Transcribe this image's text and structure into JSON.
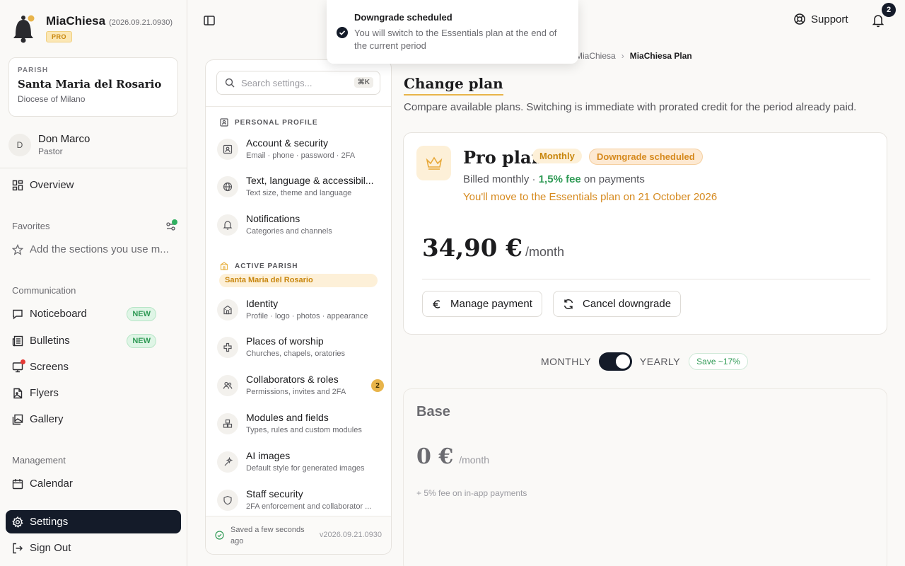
{
  "brand": {
    "name": "MiaChiesa",
    "version": "(2026.09.21.0930)",
    "badge": "PRO"
  },
  "parish": {
    "label": "PARISH",
    "name": "Santa Maria del Rosario",
    "diocese": "Diocese of Milano"
  },
  "user": {
    "initial": "D",
    "name": "Don Marco",
    "role": "Pastor"
  },
  "nav": {
    "overview": "Overview",
    "favorites_label": "Favorites",
    "favorites_hint": "Add the sections you use m...",
    "communication_label": "Communication",
    "noticeboard": "Noticeboard",
    "bulletins": "Bulletins",
    "new_badge": "NEW",
    "screens": "Screens",
    "flyers": "Flyers",
    "gallery": "Gallery",
    "management_label": "Management",
    "calendar": "Calendar",
    "settings": "Settings",
    "signout": "Sign Out"
  },
  "topbar": {
    "support": "Support",
    "notif_count": "2"
  },
  "toast": {
    "title": "Downgrade scheduled",
    "message": "You will switch to the Essentials plan at the end of the current period"
  },
  "breadcrumb": {
    "parent": "MiaChiesa",
    "current": "MiaChiesa Plan"
  },
  "settings_panel": {
    "search_placeholder": "Search settings...",
    "shortcut": "⌘K",
    "personal_label": "PERSONAL PROFILE",
    "items_personal": [
      {
        "title": "Account & security",
        "sub": "Email · phone · password · 2FA"
      },
      {
        "title": "Text, language & accessibil...",
        "sub": "Text size, theme and language"
      },
      {
        "title": "Notifications",
        "sub": "Categories and channels"
      }
    ],
    "active_parish_label": "ACTIVE PARISH",
    "active_parish_name": "Santa Maria del Rosario",
    "items_parish": [
      {
        "title": "Identity",
        "sub": "Profile · logo · photos · appearance"
      },
      {
        "title": "Places of worship",
        "sub": "Churches, chapels, oratories"
      },
      {
        "title": "Collaborators & roles",
        "sub": "Permissions, invites and 2FA",
        "count": "2"
      },
      {
        "title": "Modules and fields",
        "sub": "Types, rules and custom modules"
      },
      {
        "title": "AI images",
        "sub": "Default style for generated images"
      },
      {
        "title": "Staff security",
        "sub": "2FA enforcement and collaborator ..."
      }
    ],
    "saved": "Saved a few seconds ago",
    "version": "v2026.09.21.0930"
  },
  "main": {
    "title": "Change plan",
    "subtitle": "Compare available plans. Switching is immediate with prorated credit for the period already paid.",
    "plan": {
      "name": "Pro plan",
      "period_pill": "Monthly",
      "status_pill": "Downgrade scheduled",
      "billed_prefix": "Billed monthly · ",
      "fee": "1,5% fee",
      "billed_suffix": " on payments",
      "move_note": "You'll move to the Essentials plan on 21 October 2026",
      "price": "34,90 €",
      "unit": "/month",
      "manage_btn": "Manage payment",
      "cancel_btn": "Cancel downgrade"
    },
    "toggle": {
      "monthly": "MONTHLY",
      "yearly": "YEARLY",
      "save": "Save ~17%"
    },
    "base": {
      "title": "Base",
      "price": "0 €",
      "unit": "/month",
      "fee": "+ 5% fee on in-app payments"
    }
  }
}
